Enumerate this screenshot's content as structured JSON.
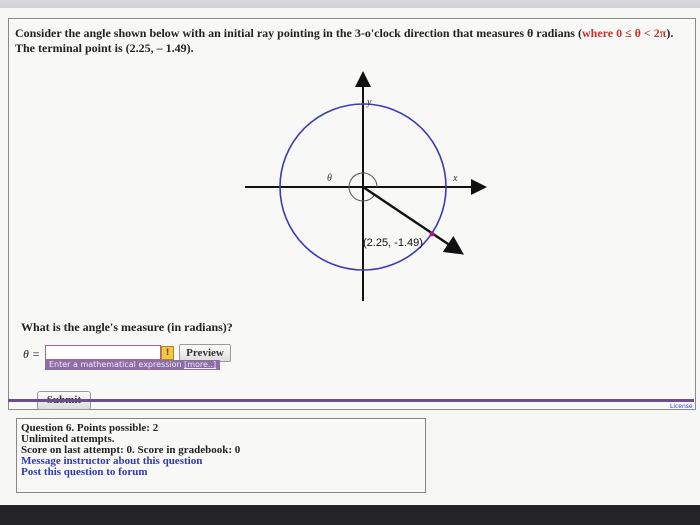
{
  "question": {
    "text_before": "Consider the angle shown below with an initial ray pointing in the 3-o'clock direction that measures θ radians (",
    "condition": "where 0 ≤ θ < 2π",
    "text_after": "). The terminal point is (2.25, – 1.49)."
  },
  "graph": {
    "y_label": "y",
    "x_label": "x",
    "theta_label": "θ",
    "point_label": "(2.25, -1.49)",
    "circle_color": "#3b3bb8",
    "axis_color": "#111111"
  },
  "answer": {
    "prompt": "What is the angle's measure (in radians)?",
    "var_label": "θ =",
    "value": "",
    "warn_icon": "!",
    "preview_label": "Preview",
    "hint": "Enter a mathematical expression",
    "hint_more": "[more..]"
  },
  "submit_label": "Submit",
  "license_label": "License",
  "info": {
    "line1": "Question 6. Points possible: 2",
    "line2": "Unlimited attempts.",
    "line3": "Score on last attempt: 0. Score in gradebook: 0",
    "link1": "Message instructor about this question",
    "link2": "Post this question to forum"
  }
}
